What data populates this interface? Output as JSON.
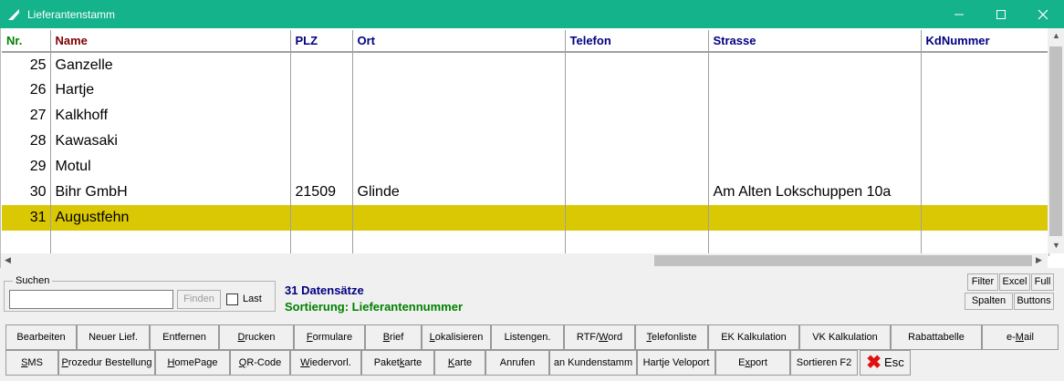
{
  "window": {
    "title": "Lieferantenstamm"
  },
  "grid": {
    "columns": [
      "Nr.",
      "Name",
      "PLZ",
      "Ort",
      "Telefon",
      "Strasse",
      "KdNummer"
    ],
    "column_colors": {
      "nr": "#008000",
      "name": "#800000",
      "other": "#000080"
    },
    "rows": [
      {
        "nr": "25",
        "name": "Ganzelle",
        "plz": "",
        "ort": "",
        "telefon": "",
        "strasse": "",
        "kdnummer": ""
      },
      {
        "nr": "26",
        "name": "Hartje",
        "plz": "",
        "ort": "",
        "telefon": "",
        "strasse": "",
        "kdnummer": ""
      },
      {
        "nr": "27",
        "name": "Kalkhoff",
        "plz": "",
        "ort": "",
        "telefon": "",
        "strasse": "",
        "kdnummer": ""
      },
      {
        "nr": "28",
        "name": "Kawasaki",
        "plz": "",
        "ort": "",
        "telefon": "",
        "strasse": "",
        "kdnummer": ""
      },
      {
        "nr": "29",
        "name": "Motul",
        "plz": "",
        "ort": "",
        "telefon": "",
        "strasse": "",
        "kdnummer": ""
      },
      {
        "nr": "30",
        "name": "Bihr GmbH",
        "plz": "21509",
        "ort": "Glinde",
        "telefon": "",
        "strasse": "Am Alten Lokschuppen 10a",
        "kdnummer": ""
      },
      {
        "nr": "31",
        "name": "Augustfehn",
        "plz": "",
        "ort": "",
        "telefon": "",
        "strasse": "",
        "kdnummer": ""
      }
    ],
    "selected_color": "#dbc805"
  },
  "search": {
    "group_label": "Suchen",
    "value": "",
    "find_label": "Finden",
    "last_label": "Last"
  },
  "status": {
    "count": "31 Datensätze",
    "sort": "Sortierung: Lieferantennummer"
  },
  "side_buttons": [
    "Filter",
    "Excel",
    "Full",
    "Spalten",
    "Buttons"
  ],
  "row1": [
    {
      "pre": "Bearbeiten",
      "ul": "",
      "post": ""
    },
    {
      "pre": "Neuer Lief.",
      "ul": "",
      "post": ""
    },
    {
      "pre": "Entfernen",
      "ul": "",
      "post": ""
    },
    {
      "pre": "",
      "ul": "D",
      "post": "rucken"
    },
    {
      "pre": "",
      "ul": "F",
      "post": "ormulare"
    },
    {
      "pre": "",
      "ul": "B",
      "post": "rief"
    },
    {
      "pre": "",
      "ul": "L",
      "post": "okalisieren"
    },
    {
      "pre": "Listengen.",
      "ul": "",
      "post": ""
    },
    {
      "pre": "RTF/",
      "ul": "W",
      "post": "ord"
    },
    {
      "pre": "",
      "ul": "T",
      "post": "elefonliste"
    },
    {
      "pre": "EK Kalkulation",
      "ul": "",
      "post": ""
    },
    {
      "pre": "VK Kalkulation",
      "ul": "",
      "post": ""
    },
    {
      "pre": "Rabattabelle",
      "ul": "",
      "post": ""
    },
    {
      "pre": "e-",
      "ul": "M",
      "post": "ail"
    }
  ],
  "row2": [
    {
      "pre": "",
      "ul": "S",
      "post": "MS"
    },
    {
      "pre": "",
      "ul": "P",
      "post": "rozedur Bestellung"
    },
    {
      "pre": "",
      "ul": "H",
      "post": "omePage"
    },
    {
      "pre": "",
      "ul": "Q",
      "post": "R-Code"
    },
    {
      "pre": "",
      "ul": "W",
      "post": "iedervorl."
    },
    {
      "pre": "Paket",
      "ul": "k",
      "post": "arte"
    },
    {
      "pre": "",
      "ul": "K",
      "post": "arte"
    },
    {
      "pre": "Anrufen",
      "ul": "",
      "post": ""
    },
    {
      "pre": "an Kundenstamm",
      "ul": "",
      "post": ""
    },
    {
      "pre": "Hartje Veloport",
      "ul": "",
      "post": ""
    },
    {
      "pre": "E",
      "ul": "x",
      "post": "port"
    },
    {
      "pre": "Sortieren F2",
      "ul": "",
      "post": ""
    }
  ],
  "esc": {
    "label": "Esc",
    "icon": "red-x-icon"
  }
}
